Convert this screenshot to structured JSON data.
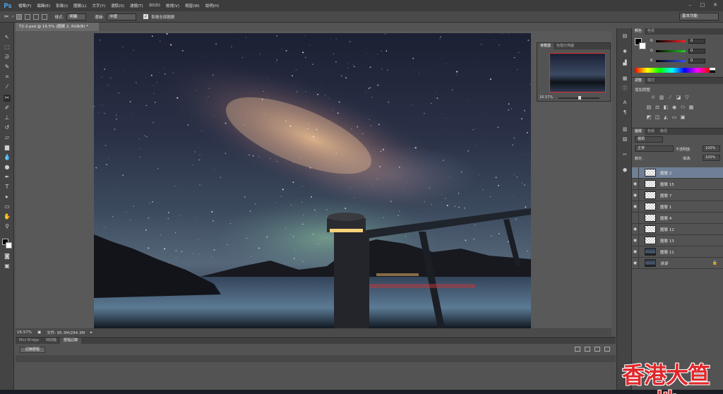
{
  "app": {
    "logo": "Ps",
    "menus": [
      "檔案(F)",
      "編輯(E)",
      "影像(I)",
      "圖層(L)",
      "文字(Y)",
      "選取(S)",
      "濾鏡(T)",
      "3D(D)",
      "檢視(V)",
      "視窗(W)",
      "說明(H)"
    ],
    "window_buttons": [
      "–",
      "□",
      "✕"
    ]
  },
  "options_bar": {
    "style_label": "樣式:",
    "style_value": "明顯",
    "threshold_label": "邊緣:",
    "threshold_value": "中度",
    "checkbox_label": "取樣全部圖層",
    "workspace": "基本功能"
  },
  "document": {
    "tab_title": "T2-2.psd @ 16.5% (圖層 2, RGB/8) *",
    "zoom": "16.57%",
    "doc_size": "文件: 95.3M/294.3M"
  },
  "bottom_panel": {
    "tabs": [
      "Mini Bridge",
      "時間軸",
      "歷程記錄"
    ],
    "button": "記錄歷程"
  },
  "navigator": {
    "tabs": [
      "導覽器",
      "色階分佈圖"
    ],
    "zoom": "16.57%"
  },
  "color_panel": {
    "tabs": [
      "顏色",
      "色票"
    ],
    "channels": [
      {
        "label": "R",
        "value": "0",
        "color": "#ff2020"
      },
      {
        "label": "G",
        "value": "0",
        "color": "#20d020"
      },
      {
        "label": "B",
        "value": "0",
        "color": "#3050ff"
      }
    ]
  },
  "adjustments_panel": {
    "tabs": [
      "調整",
      "樣式"
    ],
    "title": "增加調整"
  },
  "layers_panel": {
    "tabs": [
      "圖層",
      "色版",
      "路徑"
    ],
    "filter_label": "種類",
    "blend_mode": "正常",
    "opacity_label": "不透明度:",
    "opacity_value": "100%",
    "lock_label": "鎖定:",
    "fill_label": "填滿:",
    "fill_value": "100%",
    "layers": [
      {
        "name": "圖層 2",
        "visible": false,
        "selected": true,
        "dark": false
      },
      {
        "name": "圖層 15",
        "visible": true,
        "selected": false,
        "dark": false
      },
      {
        "name": "圖層 7",
        "visible": true,
        "selected": false,
        "dark": false
      },
      {
        "name": "圖層 1",
        "visible": true,
        "selected": false,
        "dark": false
      },
      {
        "name": "圖層 4",
        "visible": false,
        "selected": false,
        "dark": false
      },
      {
        "name": "圖層 12",
        "visible": true,
        "selected": false,
        "dark": false
      },
      {
        "name": "圖層 13",
        "visible": true,
        "selected": false,
        "dark": false
      },
      {
        "name": "圖層 11",
        "visible": true,
        "selected": false,
        "dark": true
      },
      {
        "name": "背景",
        "visible": true,
        "selected": false,
        "dark": true,
        "locked": true
      }
    ]
  },
  "watermark": "香港大笪地"
}
